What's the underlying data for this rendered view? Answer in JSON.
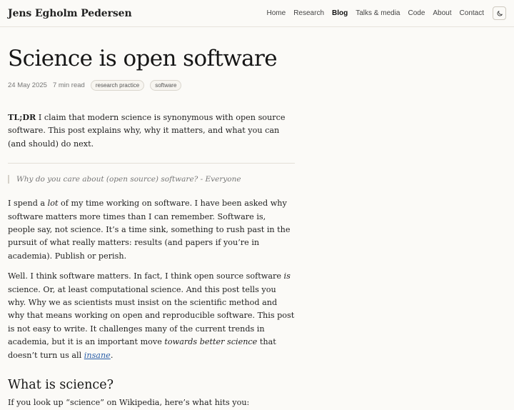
{
  "header": {
    "site_title": "Jens Egholm Pedersen",
    "nav": [
      "Home",
      "Research",
      "Blog",
      "Talks & media",
      "Code",
      "About",
      "Contact"
    ],
    "active": "Blog",
    "theme_icon": "moon-icon"
  },
  "article": {
    "title": "Science is open software",
    "date": "24 May 2025",
    "read_time": "7 min read",
    "tags": [
      "research practice",
      "software"
    ],
    "tldr_label": "TL;DR",
    "tldr_text": " I claim that modern science is synonymous with open source software. This post explains why, why it matters, and what you can (and should) do next.",
    "quote": "Why do you care about (open source) software? - Everyone",
    "p1_a": "I spend a ",
    "p1_em": "lot",
    "p1_b": " of my time working on software. I have been asked why software matters more times than I can remember. Software is, people say, not science. It’s a time sink, something to rush past in the pursuit of what really matters: results (and papers if you’re in academia). Publish or perish.",
    "p2_a": "Well. I think software matters. In fact, I think open source software ",
    "p2_em": "is",
    "p2_b": " science. Or, at least computational science. And this post tells you why. Why we as scientists must insist on the scientific method and why that means working on open and reproducible software. This post is not easy to write. It challenges many of the current trends in academia, but it is an important move ",
    "p2_em2": "towards better science",
    "p2_c": " that doesn’t turn us all ",
    "p2_link": "insane",
    "p2_d": ".",
    "h2": "What is science?",
    "p3": "If you look up “science” on Wikipedia, here’s what hits you:"
  },
  "colors": {
    "background": "#fbfaf7",
    "link": "#2a5fa8",
    "text": "#1f1f1f"
  }
}
